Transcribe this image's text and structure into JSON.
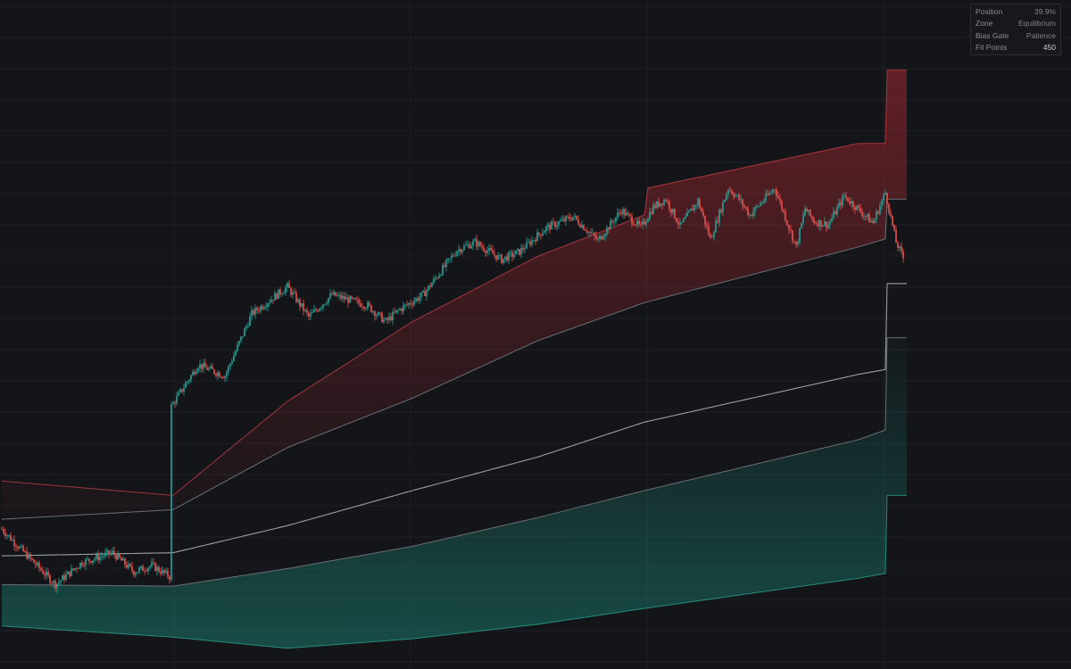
{
  "info_panel": {
    "rows": [
      {
        "label": "Position",
        "value": "39.9%"
      },
      {
        "label": "Zone",
        "value": "Equilibrium"
      },
      {
        "label": "Bias Gate",
        "value": "Patience"
      },
      {
        "label": "Fit Points",
        "value": "450"
      }
    ]
  },
  "colors": {
    "background": "#131519",
    "grid": "#1d2026",
    "bull": "#26a69a",
    "bear": "#ef5350",
    "upper_band": "#d8454c",
    "lower_band": "#2bb39c",
    "mid_line": "#9aa0a6"
  },
  "chart_data": {
    "type": "line",
    "title": "",
    "xlabel": "",
    "ylabel": "",
    "grid": true,
    "price_path_anchors": [
      [
        0,
        198
      ],
      [
        10,
        186
      ],
      [
        30,
        163
      ],
      [
        45,
        177
      ],
      [
        62,
        183
      ],
      [
        74,
        171
      ],
      [
        84,
        175
      ],
      [
        94,
        168
      ],
      [
        95,
        275
      ],
      [
        110,
        301
      ],
      [
        125,
        294
      ],
      [
        140,
        333
      ],
      [
        160,
        350
      ],
      [
        172,
        331
      ],
      [
        185,
        345
      ],
      [
        205,
        338
      ],
      [
        215,
        328
      ],
      [
        222,
        335
      ],
      [
        236,
        345
      ],
      [
        255,
        373
      ],
      [
        265,
        378
      ],
      [
        280,
        367
      ],
      [
        290,
        372
      ],
      [
        305,
        387
      ],
      [
        320,
        394
      ],
      [
        334,
        379
      ],
      [
        347,
        398
      ],
      [
        358,
        387
      ],
      [
        365,
        400
      ],
      [
        372,
        405
      ],
      [
        380,
        388
      ],
      [
        390,
        404
      ],
      [
        397,
        380
      ],
      [
        407,
        412
      ],
      [
        413,
        405
      ],
      [
        419,
        395
      ],
      [
        433,
        412
      ],
      [
        445,
        375
      ],
      [
        450,
        399
      ],
      [
        455,
        391
      ],
      [
        463,
        389
      ],
      [
        472,
        407
      ],
      [
        488,
        390
      ],
      [
        495,
        409
      ],
      [
        501,
        378
      ],
      [
        505,
        368
      ]
    ],
    "bands": {
      "upper": [
        [
          0,
          228
        ],
        [
          96,
          219
        ],
        [
          160,
          278
        ],
        [
          230,
          328
        ],
        [
          300,
          369
        ],
        [
          360,
          395
        ],
        [
          362,
          412
        ],
        [
          480,
          440
        ],
        [
          495,
          440
        ],
        [
          496,
          486
        ]
      ],
      "lower": [
        [
          0,
          137
        ],
        [
          96,
          130
        ],
        [
          160,
          123
        ],
        [
          230,
          129
        ],
        [
          300,
          138
        ],
        [
          360,
          148
        ],
        [
          480,
          167
        ],
        [
          495,
          170
        ],
        [
          496,
          219
        ]
      ],
      "mid": [
        [
          0,
          181
        ],
        [
          96,
          183
        ],
        [
          160,
          200
        ],
        [
          230,
          222
        ],
        [
          300,
          243
        ],
        [
          360,
          265
        ],
        [
          480,
          295
        ],
        [
          495,
          298
        ],
        [
          496,
          352
        ]
      ],
      "inner_upper": [
        [
          0,
          204
        ],
        [
          96,
          210
        ],
        [
          160,
          249
        ],
        [
          230,
          280
        ],
        [
          300,
          316
        ],
        [
          360,
          340
        ],
        [
          480,
          375
        ],
        [
          495,
          380
        ],
        [
          496,
          405
        ]
      ],
      "inner_lower": [
        [
          0,
          163
        ],
        [
          96,
          162
        ],
        [
          160,
          173
        ],
        [
          230,
          187
        ],
        [
          300,
          205
        ],
        [
          360,
          222
        ],
        [
          480,
          254
        ],
        [
          495,
          260
        ],
        [
          496,
          318
        ]
      ]
    }
  }
}
